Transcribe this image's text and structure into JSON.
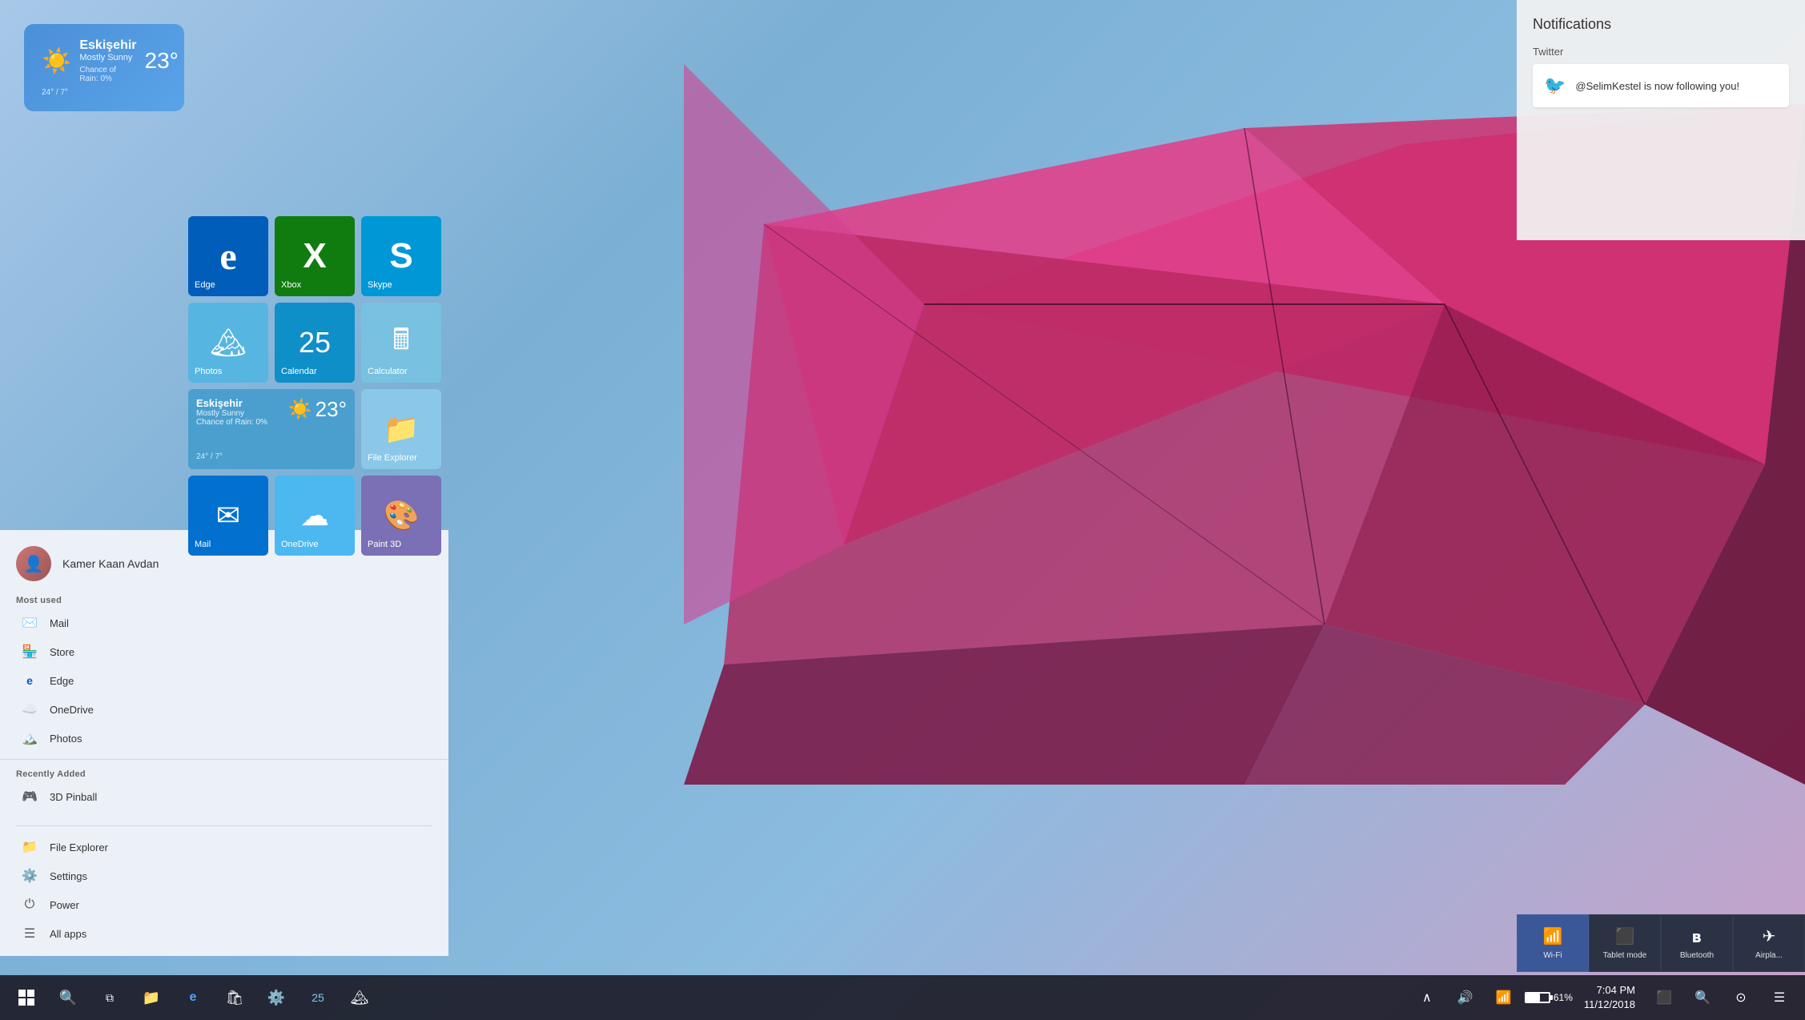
{
  "desktop": {
    "bg_gradient": "linear-gradient(135deg, #a8c8e8, #7bafd4, #8bbce0)"
  },
  "weather_widget": {
    "city": "Eskişehir",
    "condition": "Mostly Sunny",
    "rain": "Chance of Rain: 0%",
    "temp": "23°",
    "range": "24° / 7°"
  },
  "notifications": {
    "title": "Notifications",
    "twitter_section": "Twitter",
    "twitter_text": "@SelimKestel is now following you!"
  },
  "start_menu": {
    "user_name": "Kamer Kaan Avdan",
    "most_used_label": "Most used",
    "recently_added_label": "Recently Added",
    "most_used_apps": [
      {
        "name": "Mail",
        "icon": "✉"
      },
      {
        "name": "Store",
        "icon": "🛍"
      },
      {
        "name": "Edge",
        "icon": "🌐"
      },
      {
        "name": "OneDrive",
        "icon": "☁"
      },
      {
        "name": "Photos",
        "icon": "🖼"
      }
    ],
    "recently_added_apps": [
      {
        "name": "3D Pinball",
        "icon": "🎱"
      }
    ],
    "bottom_items": [
      {
        "name": "File Explorer",
        "icon": "📁"
      },
      {
        "name": "Settings",
        "icon": "⚙"
      },
      {
        "name": "Power",
        "icon": "⏻"
      },
      {
        "name": "All apps",
        "icon": "☰"
      }
    ]
  },
  "tiles": {
    "row1": [
      {
        "id": "edge",
        "label": "Edge",
        "icon": "e",
        "color": "#005dba"
      },
      {
        "id": "xbox",
        "label": "Xbox",
        "icon": "X",
        "color": "#107c10"
      },
      {
        "id": "skype",
        "label": "Skype",
        "icon": "S",
        "color": "#0097d7"
      }
    ],
    "row2": [
      {
        "id": "photos",
        "label": "Photos",
        "icon": "🏔",
        "color": "#57b5e1"
      },
      {
        "id": "calendar",
        "label": "Calendar",
        "icon": "25",
        "color": "#0f8fc8"
      },
      {
        "id": "calculator",
        "label": "Calculator",
        "icon": "🖩",
        "color": "#78c1e0"
      }
    ],
    "row3_weather": {
      "id": "weather",
      "label": "Eskişehir",
      "condition": "Mostly Sunny",
      "rain": "Chance of Rain: 0%",
      "temp": "23°",
      "range": "24° / 7°",
      "color": "#4a9fcf"
    },
    "row3_fileexplorer": {
      "id": "fileexplorer",
      "label": "File Explorer",
      "color": "#8ac7e8"
    },
    "row4": [
      {
        "id": "mail",
        "label": "Mail",
        "icon": "✉",
        "color": "#0170cf"
      },
      {
        "id": "onedrive",
        "label": "OneDrive",
        "icon": "☁",
        "color": "#4cb8f0"
      },
      {
        "id": "paint3d",
        "label": "Paint 3D",
        "icon": "🎨",
        "color": "#7b6fb5"
      }
    ]
  },
  "taskbar": {
    "start_icon": "⊞",
    "search_icon": "🔍",
    "task_view_icon": "❐",
    "file_explorer_icon": "📁",
    "edge_icon": "e",
    "store_icon": "🛍",
    "settings_icon": "⚙",
    "calendar_icon": "25",
    "photos_icon": "🏔",
    "time": "7:04 PM",
    "date": "11/12/2018",
    "battery": "61%",
    "wifi_icon": "📶",
    "volume_icon": "🔊",
    "chevron_icon": "^"
  },
  "quick_actions": [
    {
      "id": "wifi",
      "label": "Wi-Fi",
      "icon": "📶",
      "active": true
    },
    {
      "id": "tablet",
      "label": "Tablet mode",
      "icon": "⬛",
      "active": false
    },
    {
      "id": "bluetooth",
      "label": "Bluetooth",
      "icon": "ʙ",
      "active": false
    },
    {
      "id": "airplane",
      "label": "Airpla...",
      "icon": "✈",
      "active": false
    }
  ]
}
